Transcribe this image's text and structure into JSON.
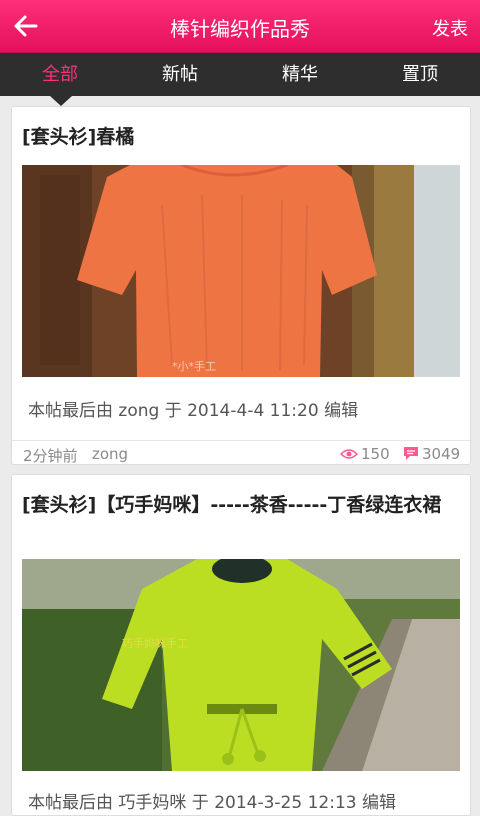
{
  "header": {
    "title": "棒针编织作品秀",
    "publish_label": "发表",
    "back_icon": "arrow-left-icon"
  },
  "tabs": [
    {
      "label": "全部",
      "active": true
    },
    {
      "label": "新帖",
      "active": false
    },
    {
      "label": "精华",
      "active": false
    },
    {
      "label": "置顶",
      "active": false
    }
  ],
  "posts": [
    {
      "title": "[套头衫]春橘",
      "edit_note": "本帖最后由 zong 于 2014-4-4 11:20 编辑",
      "time": "2分钟前",
      "author": "zong",
      "views": "150",
      "replies": "3049",
      "watermark": "*小*手工"
    },
    {
      "title": "[套头衫]【巧手妈咪】-----茶香-----丁香绿连衣裙",
      "edit_note": "本帖最后由 巧手妈咪 于 2014-3-25 12:13 编辑",
      "watermark": "巧手妈咪手工"
    }
  ],
  "colors": {
    "accent": "#ff2f79",
    "tab_bar": "#2e2e2e",
    "background": "#ebebeb"
  }
}
